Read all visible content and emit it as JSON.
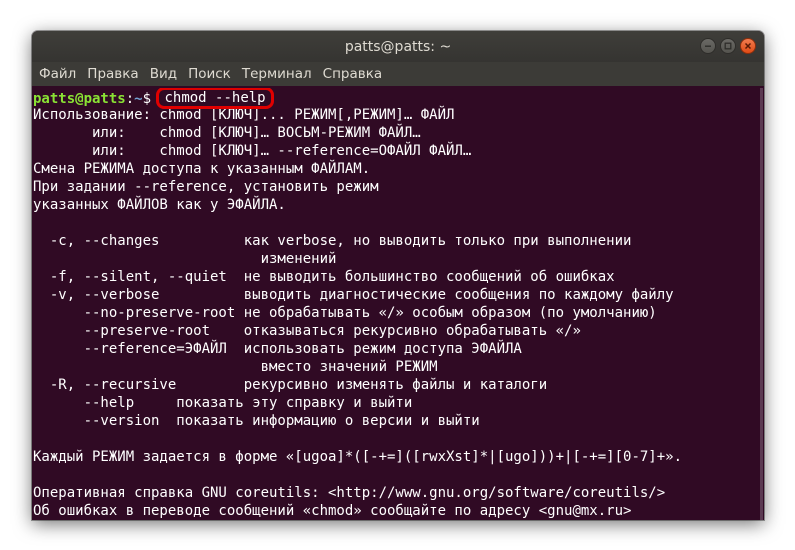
{
  "window": {
    "title": "patts@patts: ~"
  },
  "menu": {
    "items": [
      "Файл",
      "Правка",
      "Вид",
      "Поиск",
      "Терминал",
      "Справка"
    ]
  },
  "terminal": {
    "prompt_user": "patts@patts",
    "prompt_sep": ":",
    "prompt_path": "~",
    "prompt_symbol": "$",
    "command": "chmod --help",
    "output": [
      "Использование: chmod [КЛЮЧ]... РЕЖИМ[,РЕЖИМ]… ФАЙЛ",
      "       или:    chmod [КЛЮЧ]… ВОСЬМ-РЕЖИМ ФАЙЛ…",
      "       или:    chmod [КЛЮЧ]… --reference=ОФАЙЛ ФАЙЛ…",
      "Смена РЕЖИМА доступа к указанным ФАЙЛАМ.",
      "При задании --reference, установить режим",
      "указанных ФАЙЛОВ как у ЭФАЙЛА.",
      "",
      "  -c, --changes          как verbose, но выводить только при выполнении",
      "                           изменений",
      "  -f, --silent, --quiet  не выводить большинство сообщений об ошибках",
      "  -v, --verbose          выводить диагностические сообщения по каждому файлу",
      "      --no-preserve-root не обрабатывать «/» особым образом (по умолчанию)",
      "      --preserve-root    отказываться рекурсивно обрабатывать «/»",
      "      --reference=ЭФАЙЛ  использовать режим доступа ЭФАЙЛА",
      "                           вместо значений РЕЖИМ",
      "  -R, --recursive        рекурсивно изменять файлы и каталоги",
      "      --help     показать эту справку и выйти",
      "      --version  показать информацию о версии и выйти",
      "",
      "Каждый РЕЖИМ задается в форме «[ugoa]*([-+=]([rwxXst]*|[ugo]))+|[-+=][0-7]+».",
      "",
      "Оперативная справка GNU coreutils: <http://www.gnu.org/software/coreutils/>",
      "Об ошибках в переводе сообщений «chmod» сообщайте по адресу <gnu@mx.ru>"
    ]
  },
  "colors": {
    "terminal_bg": "#300a24",
    "prompt_user": "#8ae234",
    "prompt_path": "#729fcf",
    "highlight_box": "#e00000",
    "close_button": "#df4b16"
  },
  "icons": {
    "minimize": "minimize-icon",
    "maximize": "maximize-icon",
    "close": "close-icon"
  }
}
